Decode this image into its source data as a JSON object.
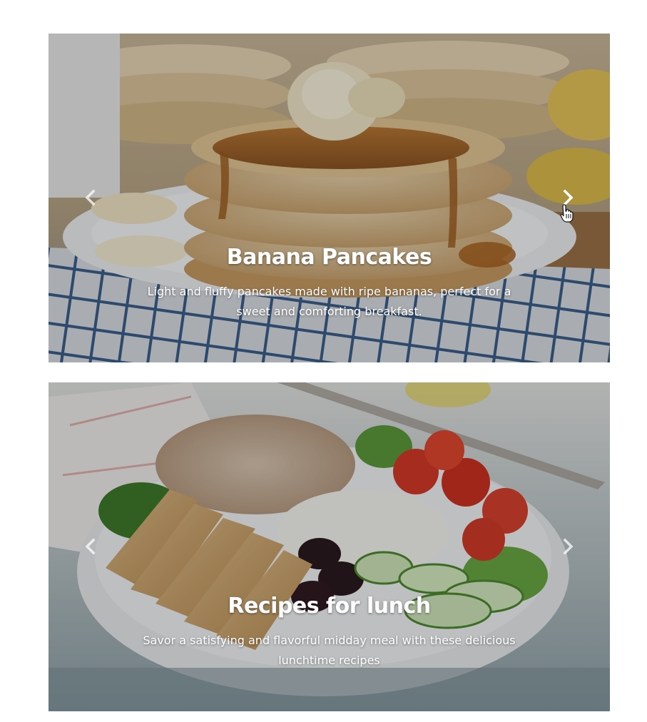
{
  "carousels": [
    {
      "title": "Banana Pancakes",
      "description": "Light and fluffy pancakes made with ripe bananas, perfect for a sweet and comforting breakfast.",
      "prev_icon": "chevron-left-icon",
      "next_icon": "chevron-right-icon"
    },
    {
      "title": "Recipes for lunch",
      "description": "Savor a satisfying and flavorful midday meal with these delicious lunchtime recipes",
      "prev_icon": "chevron-left-icon",
      "next_icon": "chevron-right-icon"
    }
  ],
  "colors": {
    "caption_text": "#ffffff",
    "control": "#ffffff",
    "page_background": "#ffffff"
  }
}
